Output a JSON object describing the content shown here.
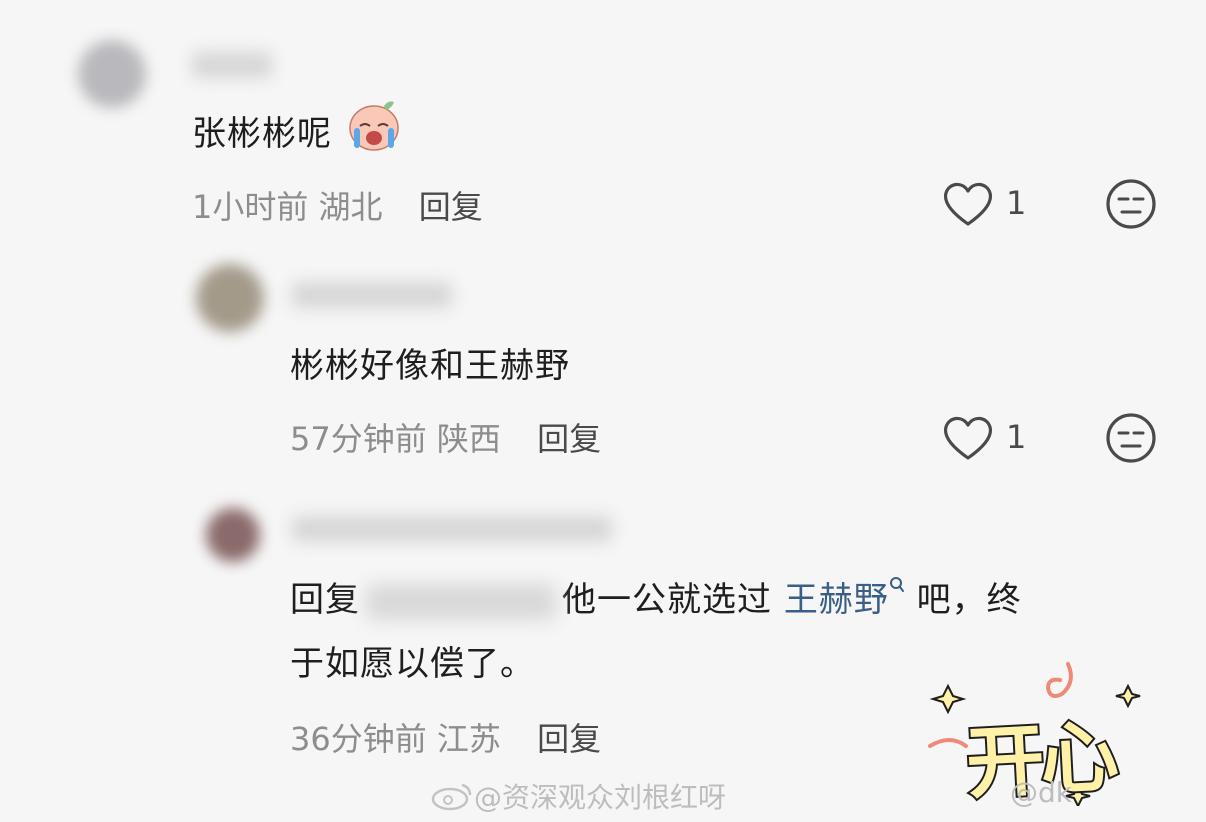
{
  "comments": [
    {
      "text": "张彬彬呢",
      "emoji": "crying-face",
      "time": "1小时前",
      "location": "湖北",
      "reply_label": "回复",
      "likes": "1"
    },
    {
      "text": "彬彬好像和王赫野",
      "time": "57分钟前",
      "location": "陕西",
      "reply_label": "回复",
      "likes": "1"
    },
    {
      "reply_prefix": "回复",
      "text_mid": "他一公就选过",
      "mention_link": "王赫野",
      "text_tail": "吧，终",
      "text_line2": "于如愿以偿了。",
      "time": "36分钟前",
      "location": "江苏",
      "reply_label": "回复"
    }
  ],
  "sticker_text": "开心",
  "watermark": {
    "left": "@资深观众刘根红呀",
    "right": "@dk"
  },
  "colors": {
    "background": "#f6f6f6",
    "link": "#3a5f86",
    "meta": "#8d8d8d"
  }
}
